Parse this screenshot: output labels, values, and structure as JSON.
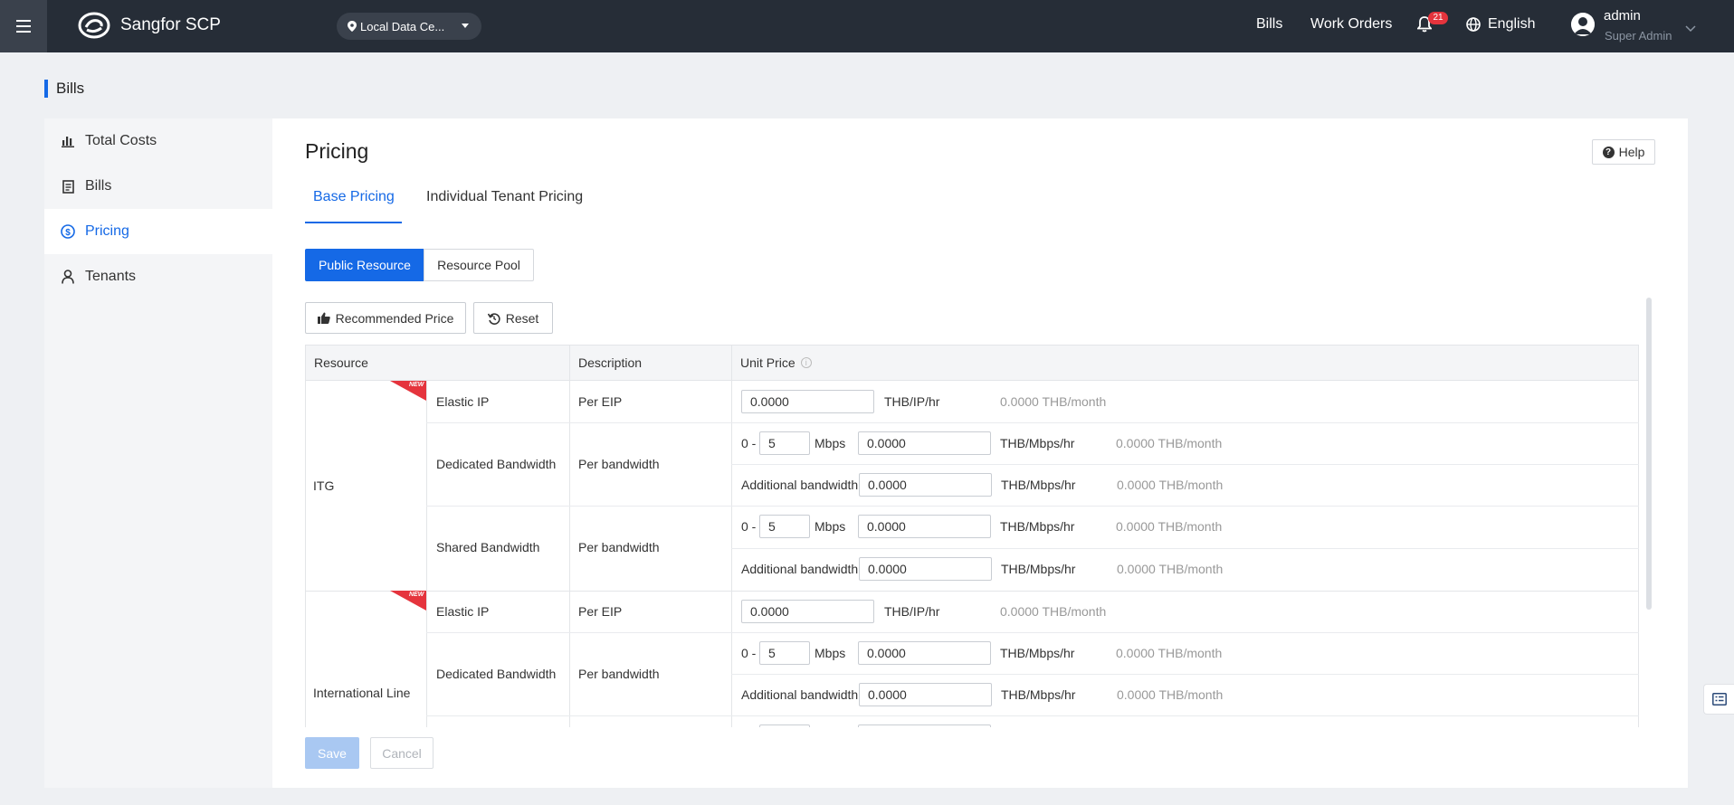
{
  "topbar": {
    "app_name": "Sangfor SCP",
    "datacenter": "Local Data Ce...",
    "links": {
      "bills": "Bills",
      "work_orders": "Work Orders"
    },
    "notifications_count": "21",
    "language": "English",
    "user": {
      "name": "admin",
      "role": "Super Admin"
    }
  },
  "page": {
    "title": "Bills"
  },
  "sidebar": {
    "items": [
      {
        "label": "Total Costs",
        "icon": "bar-chart-icon",
        "active": false
      },
      {
        "label": "Bills",
        "icon": "document-icon",
        "active": false
      },
      {
        "label": "Pricing",
        "icon": "dollar-circle-icon",
        "active": true
      },
      {
        "label": "Tenants",
        "icon": "user-icon",
        "active": false
      }
    ]
  },
  "main": {
    "title": "Pricing",
    "help": "Help",
    "tabs": [
      {
        "label": "Base Pricing",
        "active": true
      },
      {
        "label": "Individual Tenant Pricing",
        "active": false
      }
    ],
    "segments": [
      {
        "label": "Public Resource",
        "active": true
      },
      {
        "label": "Resource Pool",
        "active": false
      }
    ],
    "toolbar": {
      "recommended": "Recommended Price",
      "reset": "Reset"
    },
    "table": {
      "headers": {
        "resource": "Resource",
        "description": "Description",
        "unit_price": "Unit Price"
      },
      "new_badge": "NEW",
      "groups": [
        {
          "name": "ITG",
          "rows": {
            "elastic_ip": {
              "label": "Elastic IP",
              "desc": "Per EIP",
              "price": "0.0000",
              "unit": "THB/IP/hr",
              "monthly": "0.0000 THB/month"
            },
            "dedicated": {
              "label": "Dedicated Bandwidth",
              "desc": "Per bandwidth",
              "range_prefix": "0 -",
              "range_value": "5",
              "range_unit": "Mbps",
              "price": "0.0000",
              "unit": "THB/Mbps/hr",
              "monthly": "0.0000 THB/month",
              "additional_label": "Additional bandwidth",
              "additional_price": "0.0000",
              "additional_unit": "THB/Mbps/hr",
              "additional_monthly": "0.0000 THB/month"
            },
            "shared": {
              "label": "Shared Bandwidth",
              "desc": "Per bandwidth",
              "range_prefix": "0 -",
              "range_value": "5",
              "range_unit": "Mbps",
              "price": "0.0000",
              "unit": "THB/Mbps/hr",
              "monthly": "0.0000 THB/month",
              "additional_label": "Additional bandwidth",
              "additional_price": "0.0000",
              "additional_unit": "THB/Mbps/hr",
              "additional_monthly": "0.0000 THB/month"
            }
          }
        },
        {
          "name": "International Line",
          "rows": {
            "elastic_ip": {
              "label": "Elastic IP",
              "desc": "Per EIP",
              "price": "0.0000",
              "unit": "THB/IP/hr",
              "monthly": "0.0000 THB/month"
            },
            "dedicated": {
              "label": "Dedicated Bandwidth",
              "desc": "Per bandwidth",
              "range_prefix": "0 -",
              "range_value": "5",
              "range_unit": "Mbps",
              "price": "0.0000",
              "unit": "THB/Mbps/hr",
              "monthly": "0.0000 THB/month",
              "additional_label": "Additional bandwidth",
              "additional_price": "0.0000",
              "additional_unit": "THB/Mbps/hr",
              "additional_monthly": "0.0000 THB/month"
            }
          }
        }
      ]
    },
    "footer": {
      "save": "Save",
      "cancel": "Cancel"
    }
  }
}
